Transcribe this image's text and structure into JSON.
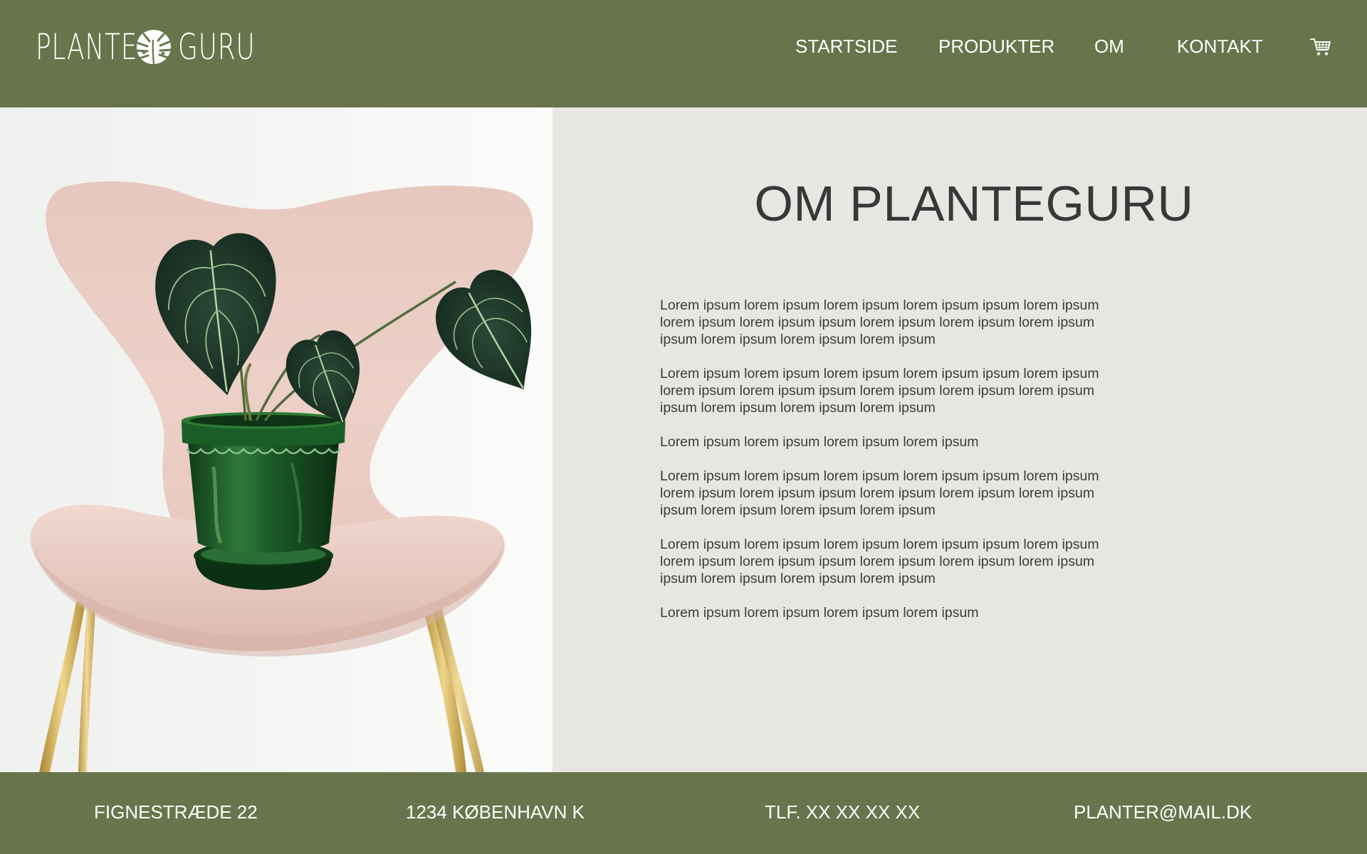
{
  "header": {
    "logo": {
      "word_1": "PLANTE",
      "word_2": "GURU",
      "icon": "monstera-leaf-icon"
    },
    "nav": {
      "items": [
        {
          "label": "STARTSIDE"
        },
        {
          "label": "PRODUKTER"
        },
        {
          "label": "OM"
        },
        {
          "label": "KONTAKT"
        }
      ],
      "cart_icon": "shopping-cart-icon"
    }
  },
  "main": {
    "image_subject": "anthurium-plant-in-green-pot-on-pink-chair",
    "title": "OM PLANTEGURU",
    "paragraphs": [
      "Lorem ipsum lorem ipsum lorem ipsum lorem ipsum ipsum lorem ipsum lorem ipsum lorem ipsum ipsum lorem ipsum lorem ipsum lorem ipsum ipsum lorem ipsum lorem ipsum lorem ipsum",
      "Lorem ipsum lorem ipsum lorem ipsum lorem ipsum ipsum lorem ipsum lorem ipsum lorem ipsum ipsum lorem ipsum lorem ipsum lorem ipsum ipsum lorem ipsum lorem ipsum lorem ipsum",
      "Lorem ipsum lorem ipsum lorem ipsum lorem ipsum",
      "Lorem ipsum lorem ipsum lorem ipsum lorem ipsum ipsum lorem ipsum lorem ipsum lorem ipsum ipsum lorem ipsum lorem ipsum lorem ipsum ipsum lorem ipsum lorem ipsum lorem ipsum",
      "Lorem ipsum lorem ipsum lorem ipsum lorem ipsum ipsum lorem ipsum lorem ipsum lorem ipsum ipsum lorem ipsum lorem ipsum lorem ipsum ipsum lorem ipsum lorem ipsum lorem ipsum",
      "Lorem ipsum lorem ipsum lorem ipsum lorem ipsum"
    ]
  },
  "footer": {
    "address": "FIGNESTRÆDE 22",
    "city": "1234 KØBENHAVN K",
    "phone": "TLF. XX XX XX XX",
    "email": "PLANTER@MAIL.DK"
  },
  "colors": {
    "brand_green": "#68744b",
    "content_bg": "#e7e6e2",
    "text_dark": "#383838",
    "text_light": "#ffffff"
  }
}
